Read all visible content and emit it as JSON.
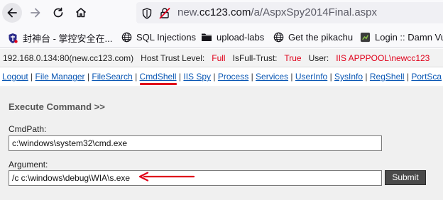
{
  "browser": {
    "url_prefix": "new.",
    "url_host": "cc123.com",
    "url_path": "/a/AspxSpy2014Final.aspx",
    "nav_icons": [
      "back-arrow-icon",
      "forward-arrow-icon",
      "reload-icon",
      "home-icon"
    ],
    "security_icons": [
      "shield-icon",
      "insecure-lock-icon"
    ]
  },
  "bookmarks": [
    {
      "label": "封神台 - 掌控安全在...",
      "icon": "shield-logo-icon"
    },
    {
      "label": "SQL Injections",
      "icon": "globe-icon"
    },
    {
      "label": "upload-labs",
      "icon": "folder-icon"
    },
    {
      "label": "Get the pikachu",
      "icon": "globe-icon"
    },
    {
      "label": "Login :: Damn Vu",
      "icon": "app-icon"
    }
  ],
  "info": {
    "address": "192.168.0.134:80(new.cc123.com)",
    "trust_label": "Host Trust Level:",
    "trust_value": "Full",
    "fulltrust_label": "IsFull-Trust:",
    "fulltrust_value": "True",
    "user_label": "User:",
    "user_value": "IIS APPPOOL\\newcc123"
  },
  "menu": {
    "items": [
      "Logout",
      "File Manager",
      "FileSearch",
      "CmdShell",
      "IIS Spy",
      "Process",
      "Services",
      "UserInfo",
      "SysInfo",
      "RegShell",
      "PortSca"
    ],
    "active": "CmdShell",
    "separator": "|"
  },
  "panel": {
    "title": "Execute Command >>",
    "cmdpath_label": "CmdPath:",
    "cmdpath_value": "c:\\windows\\system32\\cmd.exe",
    "argument_label": "Argument:",
    "argument_value": "/c c:\\windows\\debug\\WIA\\s.exe",
    "submit_label": "Submit"
  },
  "colors": {
    "accent_red": "#e0001a",
    "link_blue": "#0a57b4",
    "panel_bg": "#f0f0f0"
  }
}
